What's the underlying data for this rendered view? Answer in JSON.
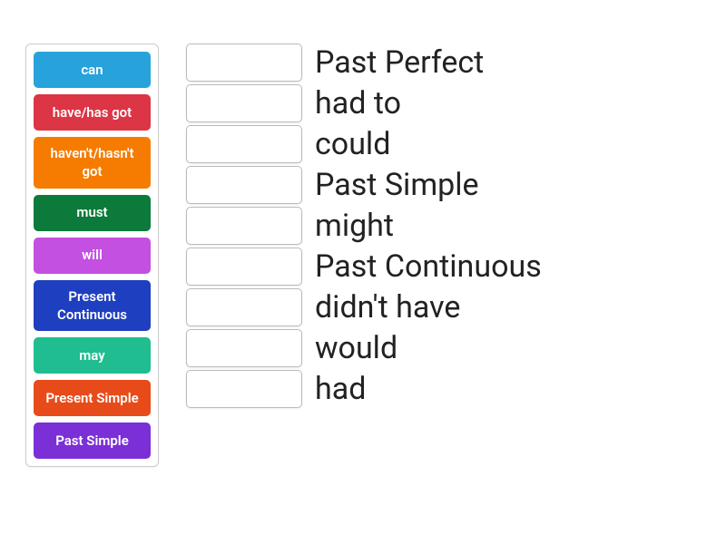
{
  "source_tiles": [
    {
      "label": "can",
      "color": "c-lightblue"
    },
    {
      "label": "have/has got",
      "color": "c-crimson"
    },
    {
      "label": "haven't/hasn't got",
      "color": "c-orange"
    },
    {
      "label": "must",
      "color": "c-darkgreen"
    },
    {
      "label": "will",
      "color": "c-magenta"
    },
    {
      "label": "Present Continuous",
      "color": "c-blue"
    },
    {
      "label": "may",
      "color": "c-teal"
    },
    {
      "label": "Present Simple",
      "color": "c-redorange"
    },
    {
      "label": "Past Simple",
      "color": "c-purple"
    }
  ],
  "targets": [
    {
      "answer": "Past Perfect"
    },
    {
      "answer": "had to"
    },
    {
      "answer": "could"
    },
    {
      "answer": "Past Simple"
    },
    {
      "answer": "might"
    },
    {
      "answer": "Past Continuous"
    },
    {
      "answer": "didn't have"
    },
    {
      "answer": "would"
    },
    {
      "answer": "had"
    }
  ]
}
